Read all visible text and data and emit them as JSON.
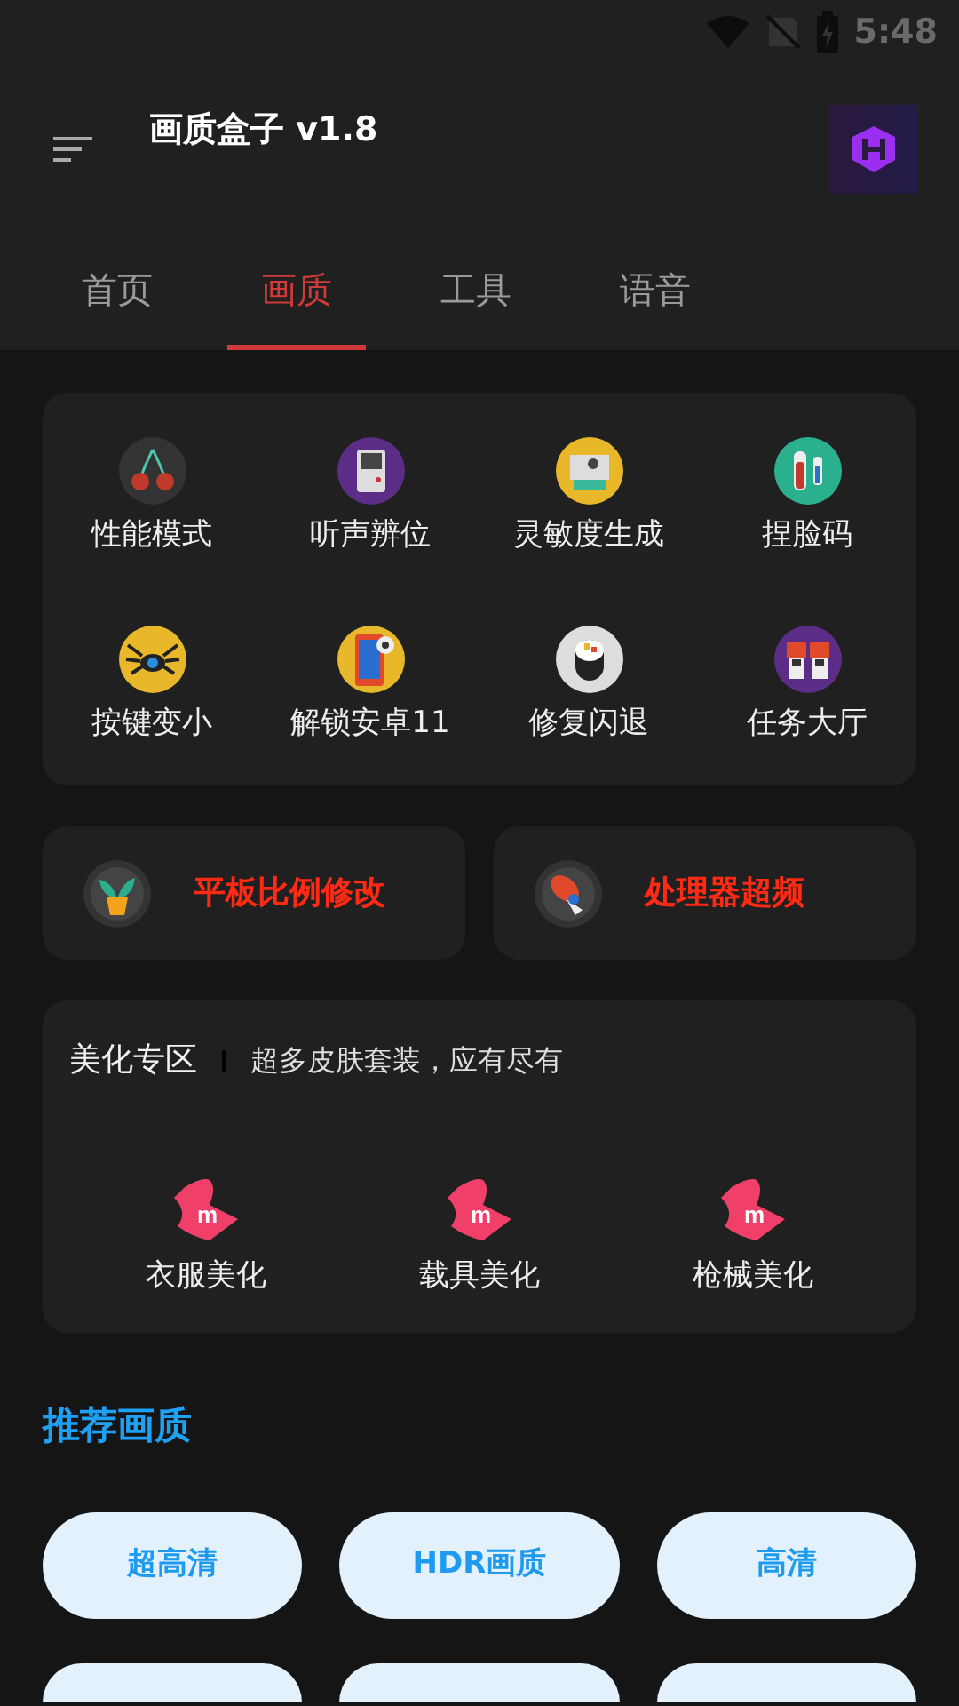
{
  "status_bar": {
    "time": "5:48"
  },
  "header": {
    "title": "画质盒子 v1.8"
  },
  "tabs": [
    {
      "label": "首页",
      "selected": false
    },
    {
      "label": "画质",
      "selected": true
    },
    {
      "label": "工具",
      "selected": false
    },
    {
      "label": "语音",
      "selected": false
    }
  ],
  "features": [
    {
      "label": "性能模式"
    },
    {
      "label": "听声辨位"
    },
    {
      "label": "灵敏度生成"
    },
    {
      "label": "捏脸码"
    },
    {
      "label": "按键变小"
    },
    {
      "label": "解锁安卓11"
    },
    {
      "label": "修复闪退"
    },
    {
      "label": "任务大厅"
    }
  ],
  "wide_cards": [
    {
      "label": "平板比例修改"
    },
    {
      "label": "处理器超频"
    }
  ],
  "beautify": {
    "title": "美化专区",
    "subtitle": "超多皮肤套装，应有尽有",
    "items": [
      {
        "label": "衣服美化",
        "logo_text": "m"
      },
      {
        "label": "载具美化",
        "logo_text": "m"
      },
      {
        "label": "枪械美化",
        "logo_text": "m"
      }
    ]
  },
  "recommended": {
    "title": "推荐画质",
    "buttons": [
      {
        "label": "超高清",
        "cut": false
      },
      {
        "label": "HDR画质",
        "cut": false
      },
      {
        "label": "高清",
        "cut": false
      },
      {
        "cut": true
      },
      {
        "cut": true
      },
      {
        "cut": true
      }
    ]
  }
}
